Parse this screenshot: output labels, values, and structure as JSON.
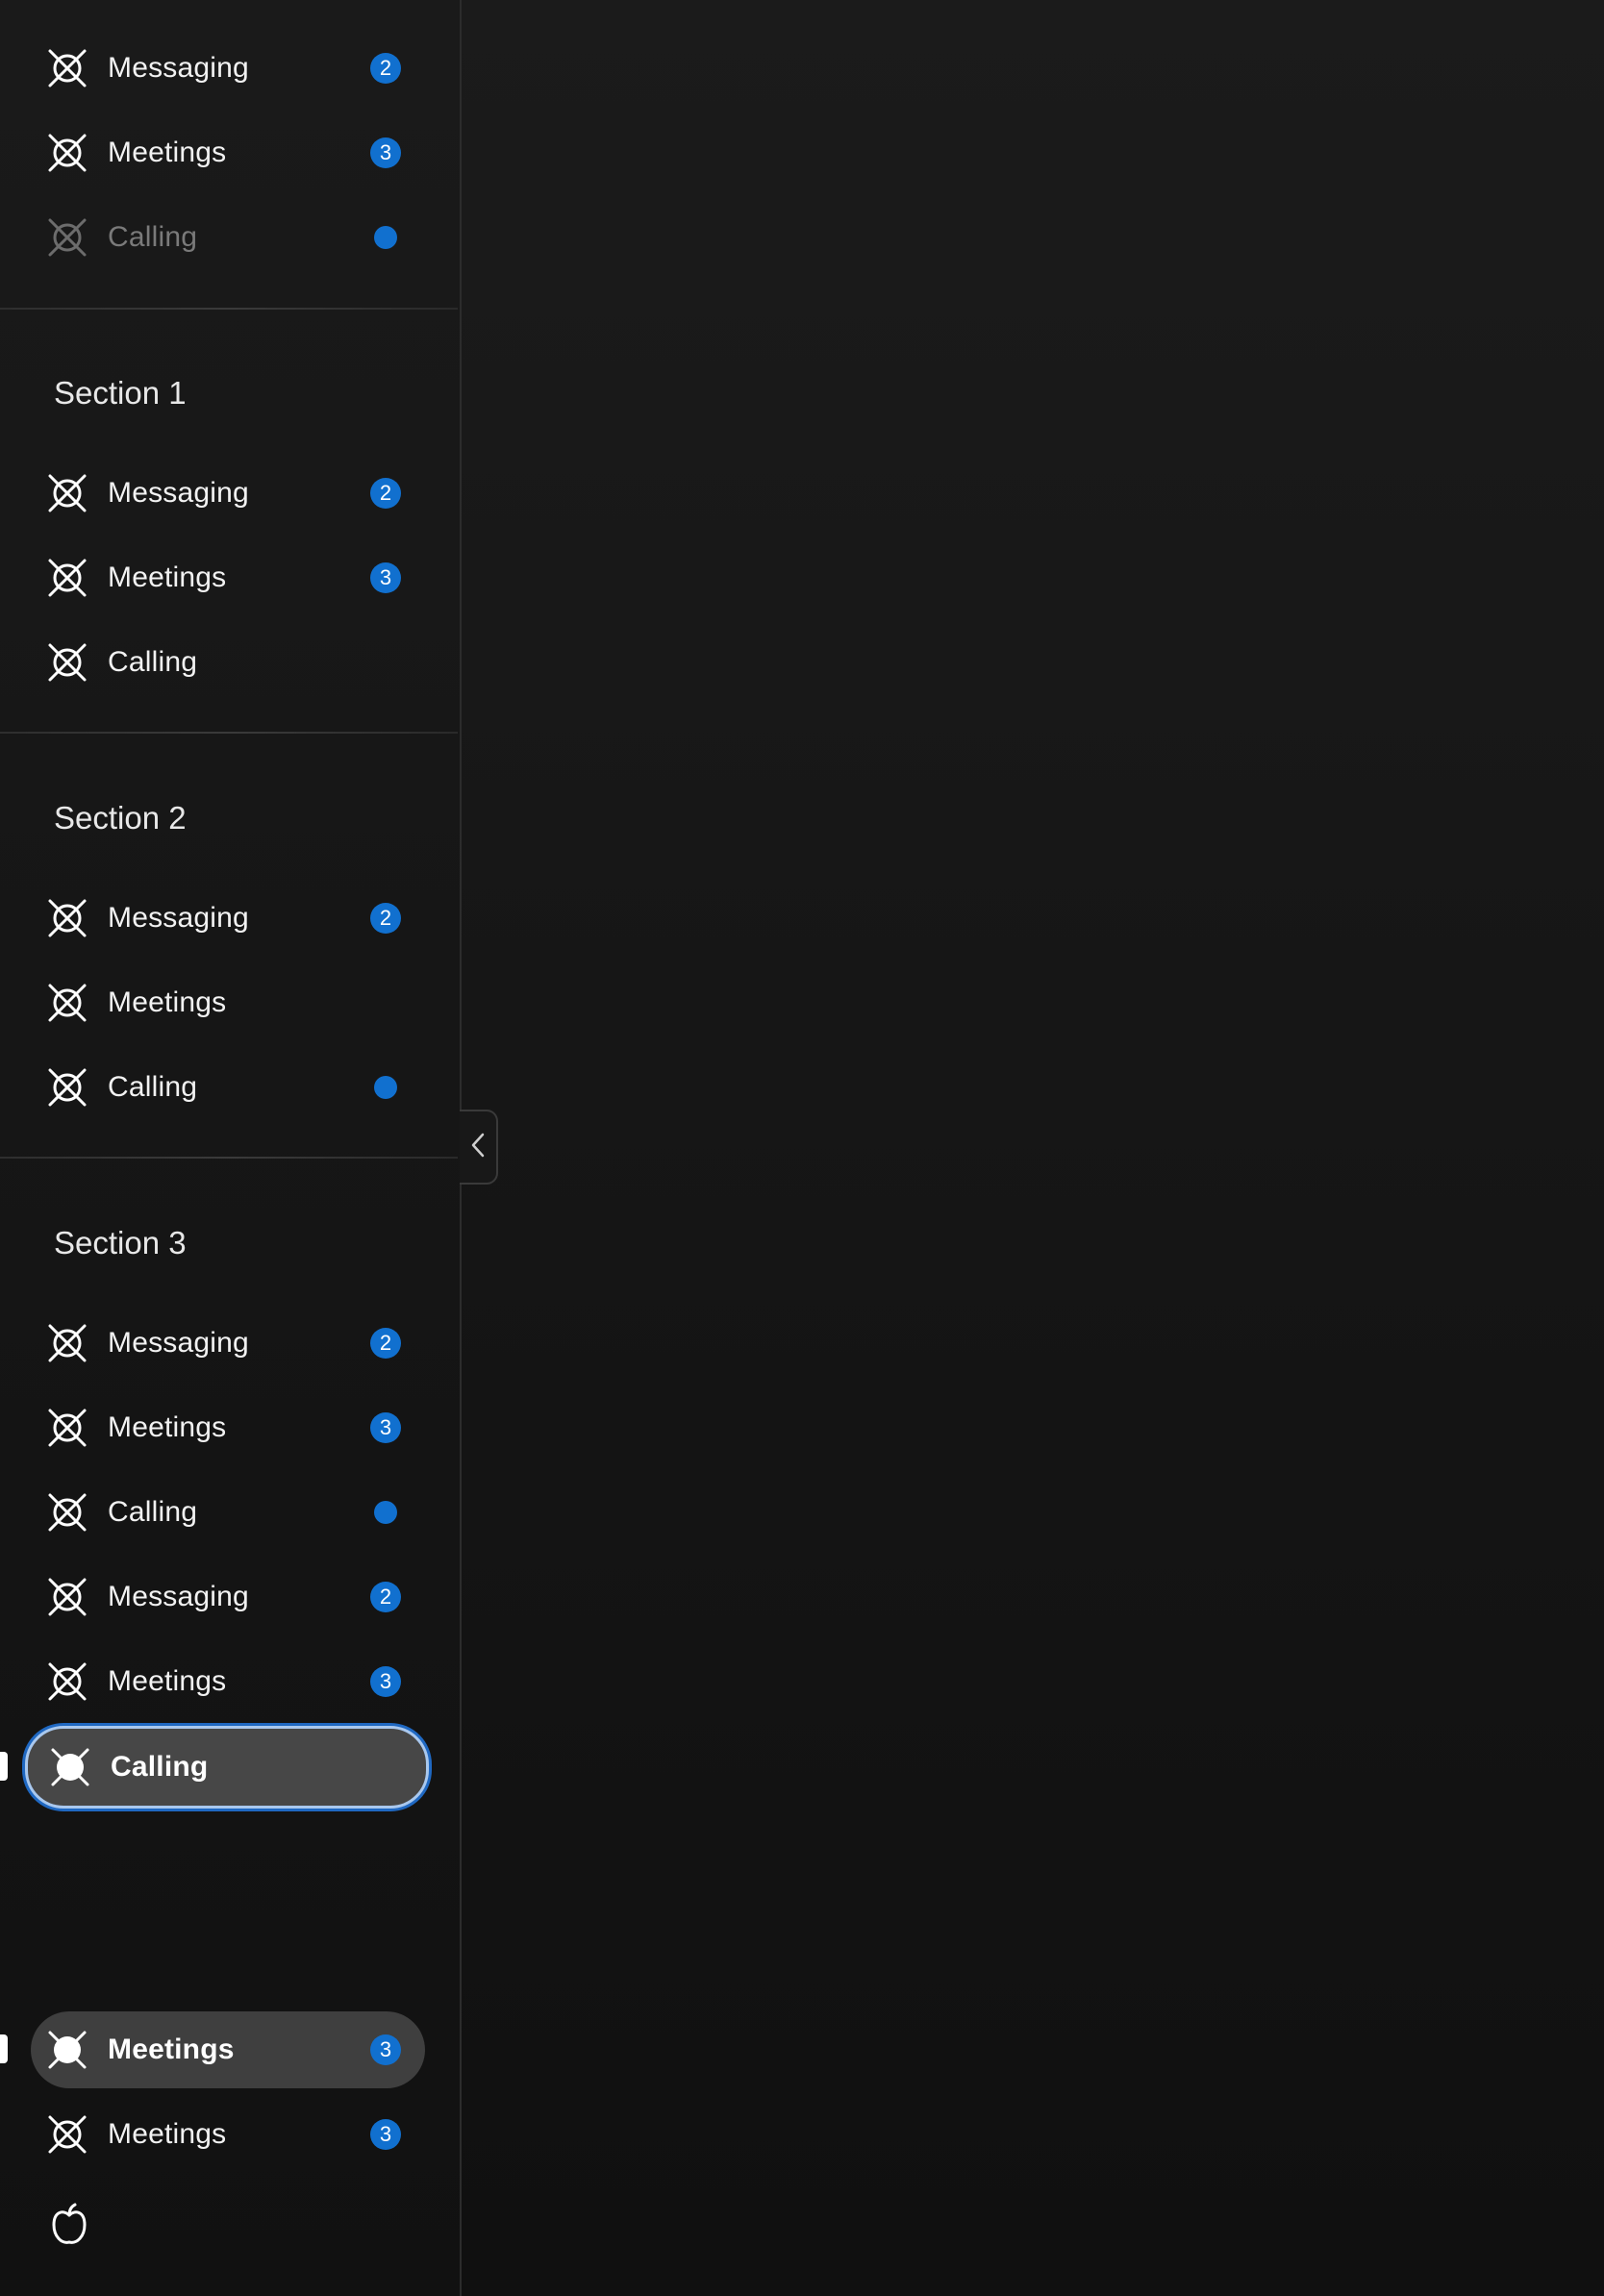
{
  "colors": {
    "accent": "#1170cf",
    "background": "#141414",
    "selected_fill": "#474747",
    "focus_ring": "#1f68c2",
    "text": "#f2f2f2",
    "disabled_text": "#7a7a7a"
  },
  "top_group": {
    "items": [
      {
        "label": "Messaging",
        "badge": "2",
        "icon": "placeholder-x-icon"
      },
      {
        "label": "Meetings",
        "badge": "3",
        "icon": "placeholder-x-icon"
      },
      {
        "label": "Calling",
        "indicator": "dot",
        "state": "disabled",
        "icon": "placeholder-x-icon"
      }
    ]
  },
  "sections": [
    {
      "title": "Section 1",
      "items": [
        {
          "label": "Messaging",
          "badge": "2",
          "icon": "placeholder-x-icon"
        },
        {
          "label": "Meetings",
          "badge": "3",
          "icon": "placeholder-x-icon"
        },
        {
          "label": "Calling",
          "icon": "placeholder-x-icon"
        }
      ]
    },
    {
      "title": "Section 2",
      "items": [
        {
          "label": "Messaging",
          "badge": "2",
          "icon": "placeholder-x-icon"
        },
        {
          "label": "Meetings",
          "icon": "placeholder-x-icon"
        },
        {
          "label": "Calling",
          "indicator": "dot",
          "icon": "placeholder-x-icon"
        }
      ]
    },
    {
      "title": "Section 3",
      "items": [
        {
          "label": "Messaging",
          "badge": "2",
          "icon": "placeholder-x-icon"
        },
        {
          "label": "Meetings",
          "badge": "3",
          "icon": "placeholder-x-icon"
        },
        {
          "label": "Calling",
          "indicator": "dot",
          "icon": "placeholder-x-icon"
        },
        {
          "label": "Messaging",
          "badge": "2",
          "icon": "placeholder-x-icon"
        },
        {
          "label": "Meetings",
          "badge": "3",
          "icon": "placeholder-x-icon"
        },
        {
          "label": "Calling",
          "state": "selected-focused",
          "icon": "placeholder-x-filled-icon"
        }
      ]
    }
  ],
  "bottom_group": {
    "items": [
      {
        "label": "Meetings",
        "badge": "3",
        "state": "selected",
        "icon": "placeholder-x-filled-icon"
      },
      {
        "label": "Meetings",
        "badge": "3",
        "icon": "placeholder-x-icon"
      }
    ],
    "footer_icon": "apple-icon"
  },
  "collapse_button": {
    "icon": "chevron-left-icon"
  }
}
